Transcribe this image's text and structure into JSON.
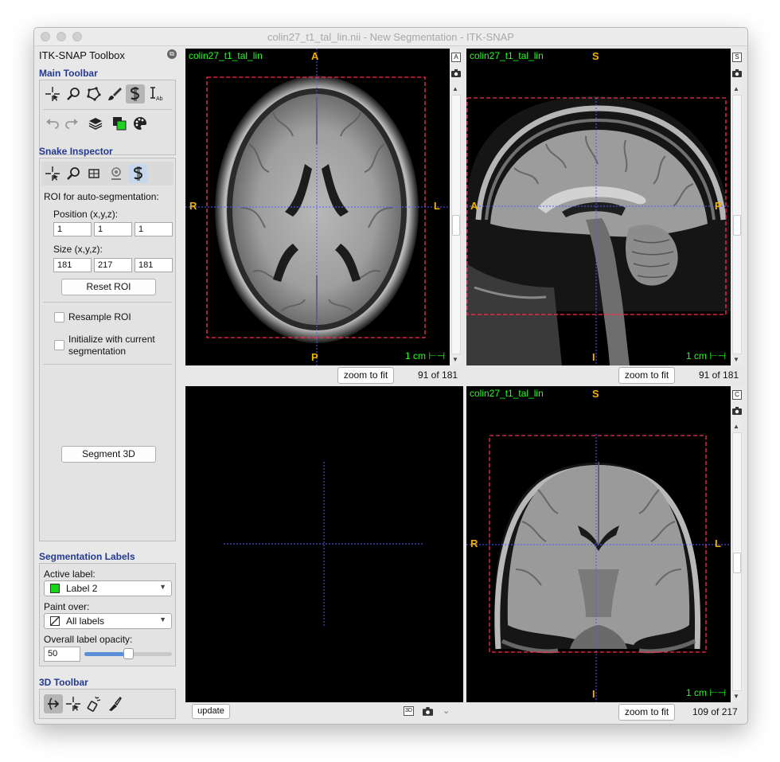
{
  "window": {
    "title": "colin27_t1_tal_lin.nii - New Segmentation - ITK-SNAP"
  },
  "toolbox": {
    "title": "ITK-SNAP Toolbox",
    "main_toolbar": {
      "title": "Main Toolbar",
      "tools": [
        "crosshair-tool",
        "zoom-tool",
        "polygon-tool",
        "paintbrush-tool",
        "snake-tool",
        "annotation-tool"
      ],
      "active": "snake-tool",
      "actions": [
        "undo",
        "redo",
        "layers",
        "label-editor",
        "color-map"
      ]
    },
    "snake_inspector": {
      "title": "Snake Inspector",
      "roi_heading": "ROI for auto-segmentation:",
      "position_label": "Position (x,y,z):",
      "position": [
        "1",
        "1",
        "1"
      ],
      "size_label": "Size (x,y,z):",
      "size": [
        "181",
        "217",
        "181"
      ],
      "reset_button": "Reset ROI",
      "resample_label": "Resample ROI",
      "init_label_1": "Initialize with current",
      "init_label_2": "segmentation",
      "segment_button": "Segment 3D"
    },
    "segmentation_labels": {
      "title": "Segmentation Labels",
      "active_label_caption": "Active label:",
      "active_label": "Label 2",
      "active_label_color": "#16d516",
      "paint_over_caption": "Paint over:",
      "paint_over": "All labels",
      "opacity_caption": "Overall label opacity:",
      "opacity": "50",
      "opacity_fraction": 0.5
    },
    "toolbar_3d": {
      "title": "3D Toolbar",
      "tools": [
        "trackball-tool",
        "crosshair-3d-tool",
        "spray-tool",
        "scalpel-tool"
      ]
    }
  },
  "views": {
    "axial": {
      "name": "colin27_t1_tal_lin",
      "top": "A",
      "bottom": "P",
      "left": "R",
      "right": "L",
      "scale": "1 cm",
      "zoom_button": "zoom to fit",
      "slice": "91 of 181",
      "mode_icon": "A"
    },
    "sagittal": {
      "name": "colin27_t1_tal_lin",
      "top": "S",
      "bottom": "I",
      "left": "A",
      "right": "P",
      "scale": "1 cm",
      "zoom_button": "zoom to fit",
      "slice": "91 of 181",
      "mode_icon": "S"
    },
    "coronal": {
      "name": "colin27_t1_tal_lin",
      "top": "S",
      "bottom": "I",
      "left": "R",
      "right": "L",
      "scale": "1 cm",
      "zoom_button": "zoom to fit",
      "slice": "109 of 217",
      "mode_icon": "C"
    },
    "three_d": {
      "update_button": "update",
      "mode_icon": "3D"
    }
  },
  "colors": {
    "roi_box": "#ff2d55",
    "crosshair": "#5a5aff",
    "annotation": "#f0b000",
    "view_label": "#22ff22",
    "section_title": "#233a8f"
  }
}
